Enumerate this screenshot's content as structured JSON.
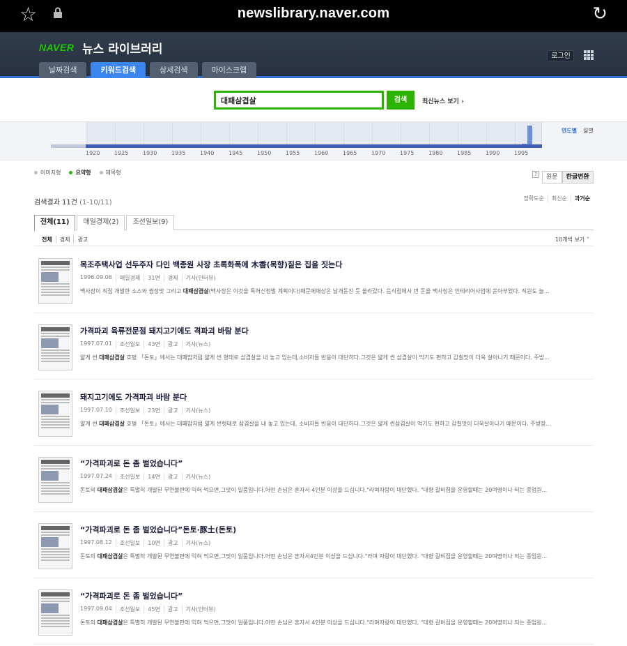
{
  "browser": {
    "url": "newslibrary.naver.com"
  },
  "header": {
    "logo": "NAVER",
    "service": "뉴스 라이브러리",
    "login": "로그인",
    "tabs": [
      "날짜검색",
      "키워드검색",
      "상세검색",
      "마이스크랩"
    ],
    "active_tab": 1
  },
  "search": {
    "query": "대패삼겹살",
    "button": "검색",
    "recent_news": "최신뉴스 보기 ›"
  },
  "timeline": {
    "years": [
      "1920",
      "1925",
      "1930",
      "1935",
      "1940",
      "1945",
      "1950",
      "1955",
      "1960",
      "1965",
      "1970",
      "1975",
      "1980",
      "1985",
      "1990",
      "1995"
    ],
    "modes": [
      "연도별",
      "월별"
    ],
    "bars": [
      {
        "year": 1996,
        "count": 1
      },
      {
        "year": 1997,
        "count": 10
      }
    ]
  },
  "view_types": [
    "이미지형",
    "요약형",
    "제목형"
  ],
  "active_view": 1,
  "help": "?",
  "convert": [
    "원문",
    "한글변환"
  ],
  "result_count": {
    "label": "검색결과 11건",
    "range": "(1-10/11)"
  },
  "sort": [
    "정확도순",
    "최신순",
    "과거순"
  ],
  "source_tabs": [
    "전체(11)",
    "매일경제(2)",
    "조선일보(9)"
  ],
  "categories": [
    "전체",
    "경제",
    "광고"
  ],
  "per_page": "10개씩 보기 ˅",
  "results": [
    {
      "title": "목조주택사업 선두주자 다인 백종원 사장 초록화폭에 木香(목향)짙은 집을 짓는다",
      "date": "1996.09.06",
      "paper": "매일경제",
      "page": "31면",
      "section": "경제",
      "type": "기사(인터뷰)",
      "pre": "백사장이 직접 개발한 소스와 쌈장맛 그리고 ",
      "kw": "대패삼겹살",
      "post": "(백사장은 이것을 특허신청벌 계획이다)때문에매상은 날개돋친 듯 올라갔다. 음식점에서 번 돈을 백사장은 인테리어사업에 쏟아부었다. 직원도 늘..."
    },
    {
      "title": "가격파괴 육류전문점 돼지고기에도 격파괴 바람 분다",
      "date": "1997.07.01",
      "paper": "조선일보",
      "page": "43면",
      "section": "광고",
      "type": "기사(뉴스)",
      "pre": "얇게 썬 ",
      "kw": "대패삼겹살",
      "post": " 호평 「돈토」에서는 대패밥처럼 얇게 썬 형태로 삼겹살을 내 놓고 있는데,소비자들 반응이 대단하다.그것은 얇게 썬 삼겹살이 먹기도 편하고 감칠맛이 더욱 살아나기 때문이다. 주방..."
    },
    {
      "title": "돼지고기에도 가격파괴 바람 분다",
      "date": "1997.07.10",
      "paper": "조선일보",
      "page": "23면",
      "section": "광고",
      "type": "기사(뉴스)",
      "pre": "얇게 썬 ",
      "kw": "대패삼겹살",
      "post": " 호평 「돈토」에서는 대패밥처럼 얇게 썬형태로 삼겹살을 내 놓고 있는데, 소비자들 반응이 대단하다.그것은 얇게 썬삼겹살이 먹기도 편하고 감칠맛이 더욱살아나기 때문이다. 주방장..."
    },
    {
      "title": "“가격파괴로 돈 좀 벌었습니다”",
      "date": "1997.07.24",
      "paper": "조선일보",
      "page": "14면",
      "section": "광고",
      "type": "기사(뉴스)",
      "pre": "돈토의 ",
      "kw": "대패삼겹살",
      "post": "은 특별히 개발된 무연불판에 익혀 먹으면,그맛이 일품입니다.어떤 손님은 혼자서 4인분 이상을 드십니다.\"라며자랑이 대단했다. \"대형 갈비집을 운영할때는 20여명이나 되는 종업원..."
    },
    {
      "title": "“가격파괴로 돈 좀 벌었습니다”돈토·豚土(돈토)",
      "date": "1997.08.12",
      "paper": "조선일보",
      "page": "10면",
      "section": "광고",
      "type": "기사(뉴스)",
      "pre": "돈토의 ",
      "kw": "대패삼겹살",
      "post": "은 특별히 개발된 무연불판에 익혀 먹으면,그맛이 일품입니다.어떤 손님은 혼자서4인분 이상을 드십니다.\"라며 자랑이 대단했다. \"대형 갈비집을 운영할때는 20여명이나 되는 종업원..."
    },
    {
      "title": "“가격파괴로 돈 좀 벌었습니다”",
      "date": "1997.09.04",
      "paper": "조선일보",
      "page": "45면",
      "section": "광고",
      "type": "기사(인터뷰)",
      "pre": "돈토의 ",
      "kw": "대패삼겹살",
      "post": "은 특별히 개발된 무연불판에 익혀 먹으면,그맛이 일품입니다.어떤 손님은 혼자서 4인분 이상을 드십니다.\"라며자랑이 대단했다, \"대형 갈비집을 운영할때는 20여명이나 되는 종업원..."
    }
  ]
}
